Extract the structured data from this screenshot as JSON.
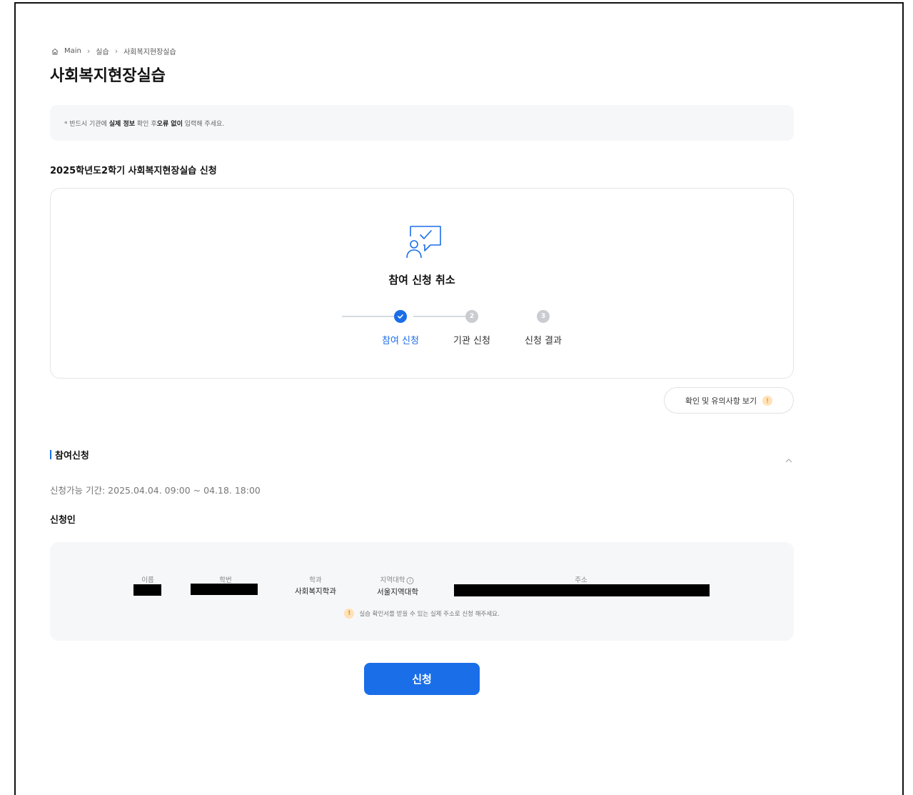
{
  "breadcrumb": {
    "items": [
      "Main",
      "실습",
      "사회복지현장실습"
    ],
    "icon": "home-icon"
  },
  "page": {
    "title": "사회복지현장실습"
  },
  "notice": {
    "prefix": "* 반드시 기관에 ",
    "bold1": "실제 정보",
    "mid1": " 확인 후",
    "bold2": "오류 없이",
    "suffix": " 입력해 주세요."
  },
  "section": {
    "title": "2025학년도2학기 사회복지현장실습 신청"
  },
  "status": {
    "icon": "person-chat-check-icon",
    "title": "참여 신청 취소",
    "steps": [
      {
        "label": "참여 신청",
        "number": "1",
        "state": "done"
      },
      {
        "label": "기관 신청",
        "number": "2",
        "state": "todo"
      },
      {
        "label": "신청 결과",
        "number": "3",
        "state": "todo"
      }
    ],
    "active_color": "#1a6ee8"
  },
  "guide_button": {
    "label": "확인 및 유의사항 보기",
    "badge": "!"
  },
  "participation": {
    "heading": "참여신청",
    "period": "신청가능 기간: 2025.04.04. 09:00 ~ 04.18. 18:00",
    "applicant_title": "신청인",
    "columns": {
      "name": {
        "label": "이름",
        "value": ""
      },
      "student_id": {
        "label": "학번",
        "value": ""
      },
      "department": {
        "label": "학과",
        "value": "사회복지학과"
      },
      "region_univ": {
        "label": "지역대학",
        "value": "서울지역대학"
      },
      "address": {
        "label": "주소",
        "value": ""
      }
    },
    "address_note": "실습 확인서를 받을 수 있는 실제 주소로 신청 해주세요.",
    "note_badge": "!"
  },
  "submit": {
    "label": "신청"
  }
}
